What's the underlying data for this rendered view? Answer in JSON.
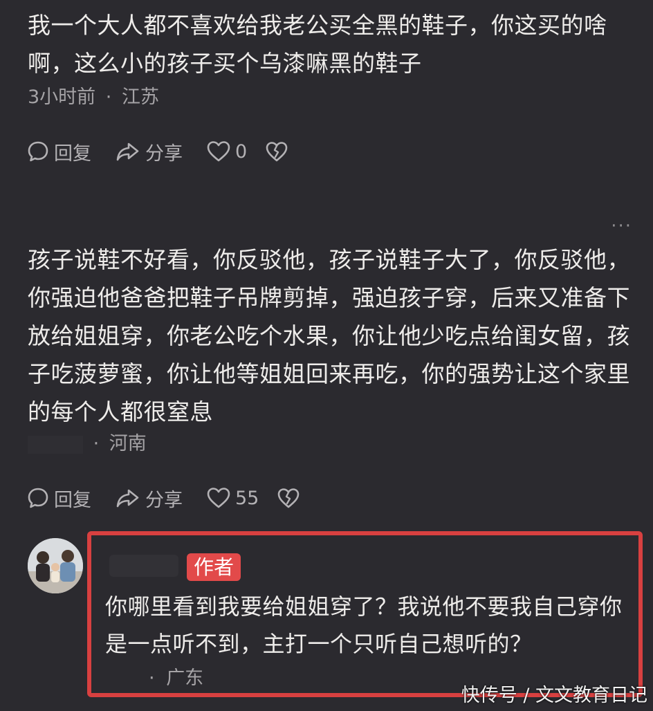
{
  "comment1": {
    "text": "我一个大人都不喜欢给我老公买全黑的鞋子，你这买的啥啊，这么小的孩子买个乌漆嘛黑的鞋子",
    "time": "3小时前",
    "separator": "·",
    "location": "江苏",
    "reply_label": "回复",
    "share_label": "分享",
    "like_count": "0",
    "icons": {
      "reply": "comment-bubble-icon",
      "share": "share-arrow-icon",
      "like": "heart-icon",
      "dislike": "broken-heart-icon"
    }
  },
  "more_label": "···",
  "comment2": {
    "text": "孩子说鞋不好看，你反驳他，孩子说鞋子大了，你反驳他，你强迫他爸爸把鞋子吊牌剪掉，强迫孩子穿，后来又准备下放给姐姐穿，你老公吃个水果，你让他少吃点给闺女留，孩子吃菠萝蜜，你让他等姐姐回来再吃，你的强势让这个家里的每个人都很窒息",
    "separator": "·",
    "location": "河南",
    "reply_label": "回复",
    "share_label": "分享",
    "like_count": "55"
  },
  "author_reply": {
    "badge": "作者",
    "text": "你哪里看到我要给姐姐穿了？我说他不要我自己穿你是一点听不到，主打一个只听自己想听的？",
    "separator": "·",
    "location": "广东"
  },
  "watermark": "快传号 / 文文教育日记",
  "colors": {
    "background": "#2b2a2f",
    "text": "#eeecea",
    "meta": "#a5a3a6",
    "badge": "#e24a4a",
    "highlight_border": "#d84040"
  }
}
